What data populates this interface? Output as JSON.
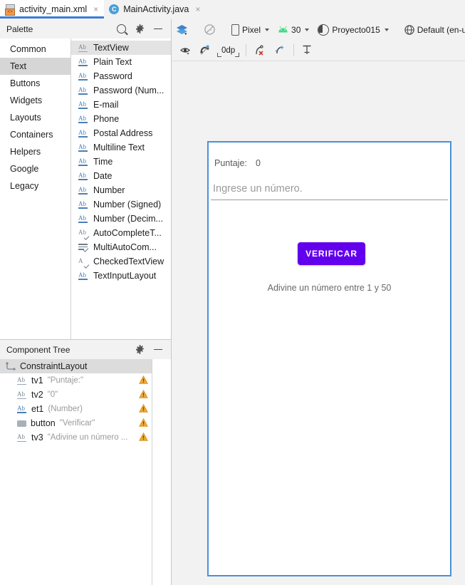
{
  "tabs": [
    {
      "label": "activity_main.xml",
      "icon": "xml-file-icon",
      "active": true,
      "close": "×"
    },
    {
      "label": "MainActivity.java",
      "icon": "java-class-icon",
      "active": false,
      "close": "×"
    }
  ],
  "palette": {
    "title": "Palette",
    "actions": [
      {
        "name": "search-icon",
        "label": "Search"
      },
      {
        "name": "gear-icon",
        "label": "Palette settings"
      },
      {
        "name": "minimize-icon",
        "label": "Minimize"
      }
    ],
    "categories": [
      {
        "label": "Common",
        "selected": false
      },
      {
        "label": "Text",
        "selected": true
      },
      {
        "label": "Buttons",
        "selected": false
      },
      {
        "label": "Widgets",
        "selected": false
      },
      {
        "label": "Layouts",
        "selected": false
      },
      {
        "label": "Containers",
        "selected": false
      },
      {
        "label": "Helpers",
        "selected": false
      },
      {
        "label": "Google",
        "selected": false
      },
      {
        "label": "Legacy",
        "selected": false
      }
    ],
    "items": [
      {
        "label": "TextView",
        "icon": "text-ab-icon",
        "selected": true
      },
      {
        "label": "Plain Text",
        "icon": "text-ab-blue-icon",
        "selected": false
      },
      {
        "label": "Password",
        "icon": "text-ab-blue-icon",
        "selected": false
      },
      {
        "label": "Password (Num...",
        "icon": "text-ab-blue-icon",
        "selected": false
      },
      {
        "label": "E-mail",
        "icon": "text-ab-blue-icon",
        "selected": false
      },
      {
        "label": "Phone",
        "icon": "text-ab-blue-icon",
        "selected": false
      },
      {
        "label": "Postal Address",
        "icon": "text-ab-blue-icon",
        "selected": false
      },
      {
        "label": "Multiline Text",
        "icon": "text-ab-blue-icon",
        "selected": false
      },
      {
        "label": "Time",
        "icon": "text-ab-blue-icon",
        "selected": false
      },
      {
        "label": "Date",
        "icon": "text-ab-blue-icon",
        "selected": false
      },
      {
        "label": "Number",
        "icon": "text-ab-blue-icon",
        "selected": false
      },
      {
        "label": "Number (Signed)",
        "icon": "text-ab-blue-icon",
        "selected": false
      },
      {
        "label": "Number (Decim...",
        "icon": "text-ab-blue-icon",
        "selected": false
      },
      {
        "label": "AutoCompleteT...",
        "icon": "autocomplete-icon",
        "selected": false
      },
      {
        "label": "MultiAutoCom...",
        "icon": "multiautocomplete-icon",
        "selected": false
      },
      {
        "label": "CheckedTextView",
        "icon": "checked-text-icon",
        "selected": false
      },
      {
        "label": "TextInputLayout",
        "icon": "text-ab-blue-icon",
        "selected": false
      }
    ]
  },
  "component_tree": {
    "title": "Component Tree",
    "actions": [
      {
        "name": "gear-icon",
        "label": "Tree settings"
      },
      {
        "name": "minimize-icon",
        "label": "Minimize"
      }
    ],
    "rows": [
      {
        "icon": "constraintlayout-icon",
        "name": "ConstraintLayout",
        "value": "",
        "warning": false,
        "selected": true,
        "indent": 0
      },
      {
        "icon": "text-ab-icon",
        "name": "tv1",
        "value": "\"Puntaje:\"",
        "warning": true,
        "selected": false,
        "indent": 1
      },
      {
        "icon": "text-ab-icon",
        "name": "tv2",
        "value": "\"0\"",
        "warning": true,
        "selected": false,
        "indent": 1
      },
      {
        "icon": "text-ab-blue-icon",
        "name": "et1",
        "value": "(Number)",
        "warning": true,
        "selected": false,
        "indent": 1
      },
      {
        "icon": "button-icon",
        "name": "button",
        "value": "\"Verificar\"",
        "warning": true,
        "selected": false,
        "indent": 1
      },
      {
        "icon": "text-ab-icon",
        "name": "tv3",
        "value": "\"Adivine un número ...",
        "warning": true,
        "selected": false,
        "indent": 1
      }
    ]
  },
  "toolbar": {
    "design_mode": {
      "name": "layers-icon",
      "label": "Design surface mode"
    },
    "zoom_fit": {
      "name": "no-scale-icon",
      "label": "Zoom to fit"
    },
    "device": {
      "label": "Pixel",
      "icon": "phone-icon"
    },
    "api": {
      "label": "30",
      "icon": "android-icon"
    },
    "theme": {
      "label": "Proyecto015",
      "icon": "theme-icon"
    },
    "locale": {
      "label": "Default (en-us)",
      "icon": "globe-icon"
    },
    "constraint_tools": [
      {
        "name": "view-options-icon",
        "label": "View options"
      },
      {
        "name": "autoconnect-magnet-icon",
        "label": "Turn on autoconnect"
      },
      {
        "name": "default-margin-value",
        "label": "0dp"
      },
      {
        "name": "clear-constraints-icon",
        "label": "Clear all constraints"
      },
      {
        "name": "infer-constraints-icon",
        "label": "Infer constraints"
      },
      {
        "name": "guidelines-icon",
        "label": "Guidelines"
      }
    ]
  },
  "preview": {
    "wrench_icon": "design-wrench-icon",
    "score_label": "Puntaje:",
    "score_value": "0",
    "input_hint": "Ingrese un número.",
    "button_label": "VERIFICAR",
    "button_color": "#6200EE",
    "hint_text": "Adivine un número entre 1 y 50",
    "frame_border_color": "#4A90D9"
  }
}
